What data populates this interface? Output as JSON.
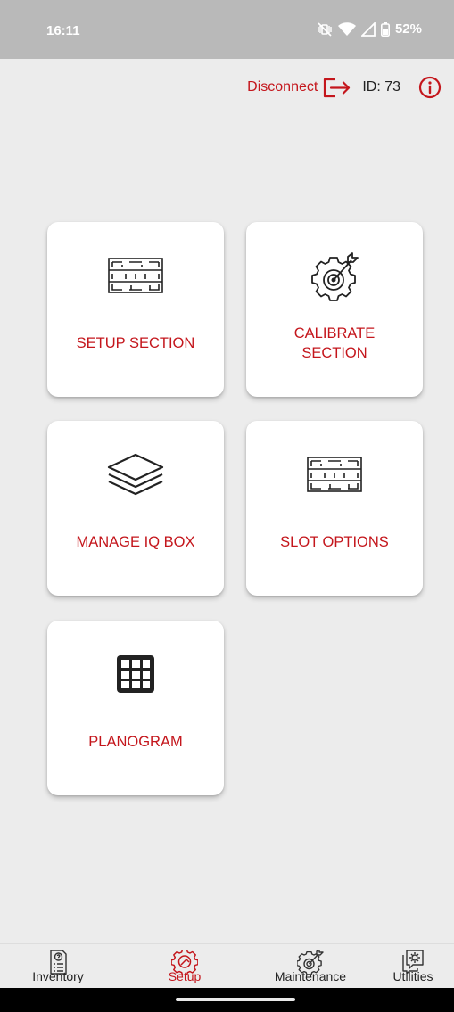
{
  "status_bar": {
    "time": "16:11",
    "battery": "52%",
    "icons": [
      "vibrate-off-icon",
      "wifi-icon",
      "signal-icon",
      "battery-icon"
    ]
  },
  "header": {
    "disconnect_label": "Disconnect",
    "device_id": "ID: 73",
    "icons": [
      "logout-icon",
      "info-icon"
    ]
  },
  "cards": [
    {
      "label": "SETUP SECTION",
      "icon": "shelf-grid-icon"
    },
    {
      "label": "CALIBRATE SECTION",
      "icon": "gear-target-icon"
    },
    {
      "label": "MANAGE IQ BOX",
      "icon": "layers-icon"
    },
    {
      "label": "SLOT OPTIONS",
      "icon": "shelf-grid-icon"
    },
    {
      "label": "PLANOGRAM",
      "icon": "grid-icon"
    }
  ],
  "bottom_nav": [
    {
      "label": "Inventory",
      "icon": "inventory-icon",
      "active": false
    },
    {
      "label": "Setup",
      "icon": "setup-gear-icon",
      "active": true
    },
    {
      "label": "Maintenance",
      "icon": "maintenance-gear-icon",
      "active": false
    },
    {
      "label": "Utilities",
      "icon": "utilities-icon",
      "active": false
    }
  ],
  "colors": {
    "accent": "#c4161c",
    "background": "#ececec",
    "card": "#ffffff",
    "status_bar": "#b9b9b9"
  }
}
